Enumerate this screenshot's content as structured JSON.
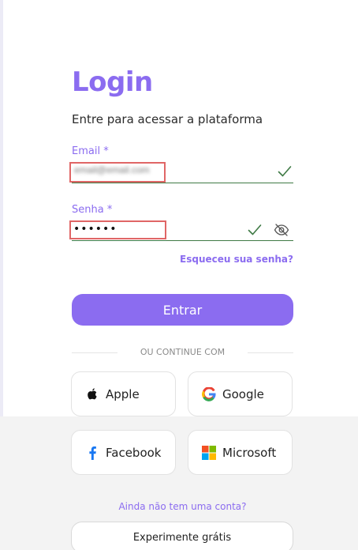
{
  "login": {
    "title": "Login",
    "subtitle": "Entre para acessar a plataforma",
    "email": {
      "label": "Email",
      "required_mark": "*",
      "value": "email@email.com",
      "valid_icon": "check-icon"
    },
    "password": {
      "label": "Senha",
      "required_mark": "*",
      "value": "••••••",
      "valid_icon": "check-icon",
      "toggle_icon": "eye-off-icon"
    },
    "forgot_password": "Esqueceu sua senha?",
    "submit_label": "Entrar",
    "divider_text": "OU CONTINUE COM",
    "social": [
      {
        "label": "Apple",
        "icon": "apple-icon"
      },
      {
        "label": "Google",
        "icon": "google-icon"
      },
      {
        "label": "Facebook",
        "icon": "facebook-icon"
      },
      {
        "label": "Microsoft",
        "icon": "microsoft-icon"
      }
    ],
    "signup_prompt": "Ainda não tem uma conta?",
    "signup_label": "Experimente grátis"
  },
  "colors": {
    "accent": "#8b6cf0",
    "valid": "#3f7a45",
    "highlight": "#e06666"
  }
}
